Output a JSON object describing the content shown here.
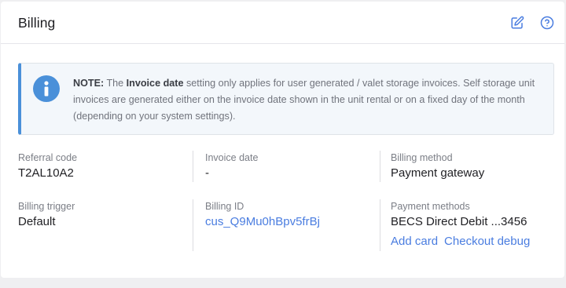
{
  "card": {
    "title": "Billing",
    "icons": [
      "edit-icon",
      "help-icon"
    ]
  },
  "note": {
    "icon": "info-icon",
    "prefix": "NOTE:",
    "text_1": "The",
    "bold_term": "Invoice date",
    "text_2": "setting only applies for user generated / valet storage invoices. Self storage unit invoices are generated either on the invoice date shown in the unit rental or on a fixed day of the month (depending on your system settings)."
  },
  "fields": {
    "referral_code": {
      "label": "Referral code",
      "value": "T2AL10A2"
    },
    "invoice_date": {
      "label": "Invoice date",
      "value": "-"
    },
    "billing_method": {
      "label": "Billing method",
      "value": "Payment gateway"
    },
    "billing_trigger": {
      "label": "Billing trigger",
      "value": "Default"
    },
    "billing_id": {
      "label": "Billing ID",
      "value": "cus_Q9Mu0hBpv5frBj"
    },
    "payment_methods": {
      "label": "Payment methods",
      "value": "BECS Direct Debit ...3456",
      "add_card": "Add card",
      "checkout_debug": "Checkout debug"
    }
  },
  "colors": {
    "accent": "#4a90d9",
    "link": "#4a7de0",
    "note_bg": "#f3f7fb"
  }
}
